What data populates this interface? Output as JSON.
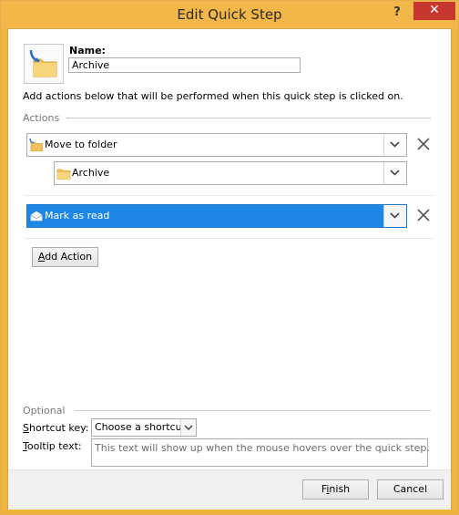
{
  "window": {
    "title": "Edit Quick Step",
    "help_glyph": "?",
    "close_glyph": "✕",
    "accent_color": "#f2b649"
  },
  "name_section": {
    "label": "Name:",
    "value": "Archive"
  },
  "instructions": "Add actions below that will be performed when this quick step is clicked on.",
  "actions": {
    "group_label": "Actions",
    "items": [
      {
        "label": "Move to folder",
        "icon": "move-folder-icon",
        "selected": false,
        "sub": {
          "label": "Archive",
          "icon": "folder-icon"
        }
      },
      {
        "label": "Mark as read",
        "icon": "envelope-open-icon",
        "selected": true
      }
    ],
    "add_button": {
      "prefix": "",
      "underlined": "A",
      "rest": "dd Action"
    }
  },
  "optional": {
    "group_label": "Optional",
    "shortcut_label": {
      "prefix": "",
      "underlined": "S",
      "rest": "hortcut key:"
    },
    "shortcut_value": "Choose a shortcut",
    "tooltip_label": {
      "prefix": "",
      "underlined": "T",
      "rest": "ooltip text:"
    },
    "tooltip_placeholder": "This text will show up when the mouse hovers over the quick step."
  },
  "footer": {
    "finish": {
      "prefix": "F",
      "underlined": "i",
      "rest": "nish"
    },
    "cancel": "Cancel"
  },
  "colors": {
    "selection": "#1e87e6",
    "close_red": "#c7372f",
    "folder": "#f0c25e"
  }
}
